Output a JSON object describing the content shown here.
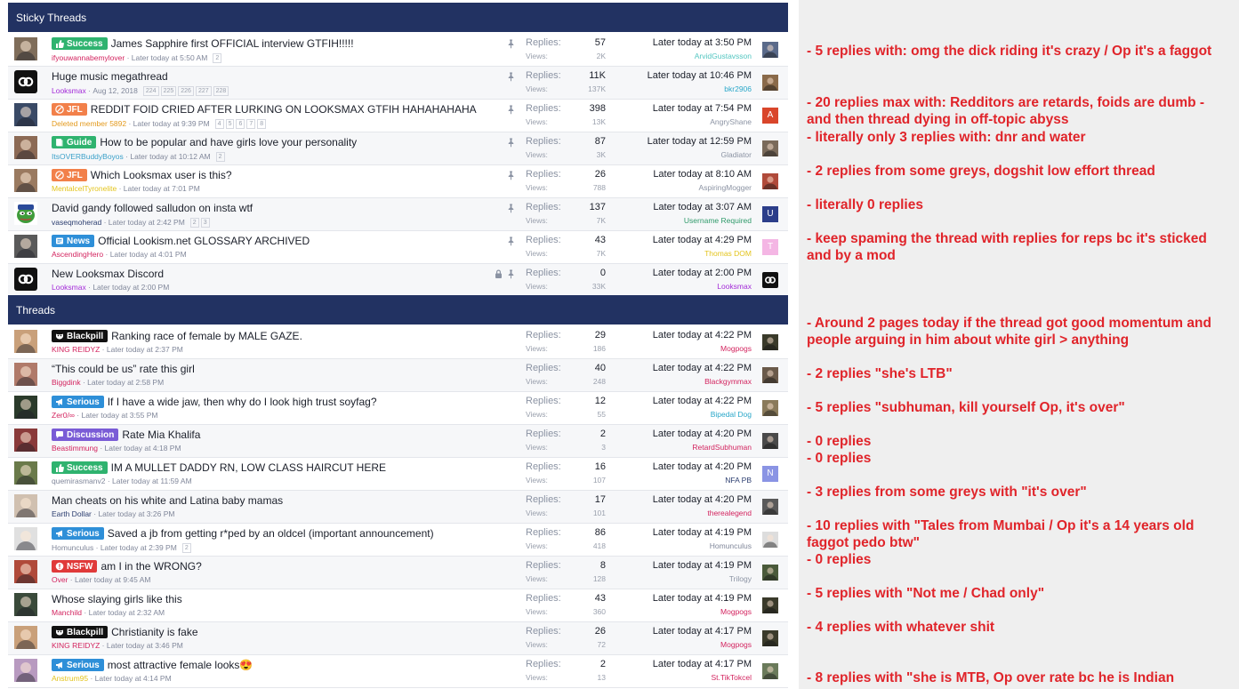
{
  "sticky_header": "Sticky Threads",
  "threads_header": "Threads",
  "labels": {
    "replies": "Replies:",
    "views": "Views:"
  },
  "sticky": [
    {
      "title": "James Sapphire first OFFICIAL interview GTFIH!!!!!",
      "prefix": "Success",
      "prefix_color": "#2fb36f",
      "prefix_icon": "thumbs-up-icon",
      "author": "ifyouwannabemylover",
      "author_color": "#d3245f",
      "date": "Later today at 5:50 AM",
      "pages": [
        "2"
      ],
      "replies": "57",
      "views": "2K",
      "last_time": "Later today at 3:50 PM",
      "last_user": "ArvidGustavsson",
      "last_user_color": "#53c6c1",
      "avatar_bg": "#7f6d5a",
      "mini_bg": "#5a6a8a",
      "locked": false
    },
    {
      "title": "Huge music megathread",
      "prefix": "",
      "author": "Looksmax",
      "author_color": "#a32bd8",
      "date": "Aug 12, 2018",
      "pages": [
        "224",
        "225",
        "226",
        "227",
        "228"
      ],
      "replies": "11K",
      "views": "137K",
      "last_time": "Later today at 10:46 PM",
      "last_user": "bkr2906",
      "last_user_color": "#2aa7c9",
      "avatar_bg": "#111111",
      "avatar_logo": true,
      "mini_bg": "#8a6a4a",
      "locked": false
    },
    {
      "title": "REDDIT FOID CRIED AFTER LURKING ON LOOKSMAX GTFIH HAHAHAHAHA",
      "prefix": "JFL",
      "prefix_color": "#f2804a",
      "prefix_icon": "no-entry-icon",
      "author": "Deleted member 5892",
      "author_color": "#e39a1d",
      "date": "Later today at 9:39 PM",
      "pages": [
        "4",
        "5",
        "6",
        "7",
        "8"
      ],
      "replies": "398",
      "views": "13K",
      "last_time": "Later today at 7:54 PM",
      "last_user": "AngryShane",
      "last_user_color": "#8b93a3",
      "avatar_bg": "#3a4a66",
      "mini_bg": "#d9462b",
      "mini_letter": "A",
      "locked": false
    },
    {
      "title": "How to be popular and have girls love your personality",
      "prefix": "Guide",
      "prefix_color": "#2fb36f",
      "prefix_icon": "book-icon",
      "author": "ItsOVERBuddyBoyos",
      "author_color": "#3aa0c9",
      "date": "Later today at 10:12 AM",
      "pages": [
        "2"
      ],
      "replies": "87",
      "views": "3K",
      "last_time": "Later today at 12:59 PM",
      "last_user": "Gladiator",
      "last_user_color": "#8b93a3",
      "avatar_bg": "#8c6a55",
      "mini_bg": "#7a6a5a",
      "locked": false
    },
    {
      "title": "Which Looksmax user is this?",
      "prefix": "JFL",
      "prefix_color": "#f2804a",
      "prefix_icon": "no-entry-icon",
      "author": "MentalcelTyronelite",
      "author_color": "#e3c41d",
      "date": "Later today at 7:01 PM",
      "pages": [],
      "replies": "26",
      "views": "788",
      "last_time": "Later today at 8:10 AM",
      "last_user": "AspiringMogger",
      "last_user_color": "#8b93a3",
      "avatar_bg": "#9a7a60",
      "mini_bg": "#b04a3a",
      "locked": false
    },
    {
      "title": "David gandy followed salludon on insta wtf",
      "prefix": "",
      "author": "vaseqmoherad",
      "author_color": "#2c3e70",
      "date": "Later today at 2:42 PM",
      "pages": [
        "2",
        "3"
      ],
      "replies": "137",
      "views": "7K",
      "last_time": "Later today at 3:07 AM",
      "last_user": "Username Required",
      "last_user_color": "#2f9a6a",
      "avatar_bg": "#ffffff",
      "avatar_pepe": true,
      "mini_bg": "#2c3e8a",
      "mini_letter": "U",
      "locked": false
    },
    {
      "title": "Official Lookism.net GLOSSARY ARCHIVED",
      "prefix": "News",
      "prefix_color": "#2e8fd8",
      "prefix_icon": "newspaper-icon",
      "author": "AscendingHero",
      "author_color": "#d3245f",
      "date": "Later today at 4:01 PM",
      "pages": [],
      "replies": "43",
      "views": "7K",
      "last_time": "Later today at 4:29 PM",
      "last_user": "Thomas DOM",
      "last_user_color": "#e3c41d",
      "avatar_bg": "#5a5a5a",
      "mini_bg": "#f4b6e4",
      "mini_letter": "T",
      "locked": false
    },
    {
      "title": "New Looksmax Discord",
      "prefix": "",
      "author": "Looksmax",
      "author_color": "#a32bd8",
      "date": "Later today at 2:00 PM",
      "pages": [],
      "replies": "0",
      "views": "33K",
      "last_time": "Later today at 2:00 PM",
      "last_user": "Looksmax",
      "last_user_color": "#a32bd8",
      "avatar_bg": "#111111",
      "avatar_logo": true,
      "mini_bg": "#111111",
      "mini_logo": true,
      "locked": true
    }
  ],
  "threads": [
    {
      "title": "Ranking race of female by MALE GAZE.",
      "prefix": "Blackpill",
      "prefix_color": "#111111",
      "prefix_icon": "mask-icon",
      "author": "KING REIDYZ",
      "author_color": "#d3245f",
      "date": "Later today at 2:37 PM",
      "pages": [],
      "replies": "29",
      "views": "186",
      "last_time": "Later today at 4:22 PM",
      "last_user": "Mogpogs",
      "last_user_color": "#d3245f",
      "avatar_bg": "#c9a07a",
      "mini_bg": "#3a3a2a"
    },
    {
      "title": "“This could be us” rate this girl",
      "prefix": "",
      "author": "Biggdink",
      "author_color": "#d3245f",
      "date": "Later today at 2:58 PM",
      "pages": [],
      "replies": "40",
      "views": "248",
      "last_time": "Later today at 4:22 PM",
      "last_user": "Blackgymmax",
      "last_user_color": "#d3245f",
      "avatar_bg": "#b07a6a",
      "mini_bg": "#6a5a4a"
    },
    {
      "title": "If I have a wide jaw, then why do I look high trust soyfag?",
      "prefix": "Serious",
      "prefix_color": "#2e8fd8",
      "prefix_icon": "megaphone-icon",
      "author": "Zer0/∞",
      "author_color": "#d3245f",
      "date": "Later today at 3:55 PM",
      "pages": [],
      "replies": "12",
      "views": "55",
      "last_time": "Later today at 4:22 PM",
      "last_user": "Bipedal Dog",
      "last_user_color": "#2aa7c9",
      "avatar_bg": "#2a3a2a",
      "mini_bg": "#8a7a5a"
    },
    {
      "title": "Rate Mia Khalifa",
      "prefix": "Discussion",
      "prefix_color": "#7a5cd6",
      "prefix_icon": "chat-icon",
      "author": "Beastimmung",
      "author_color": "#d3245f",
      "date": "Later today at 4:18 PM",
      "pages": [],
      "replies": "2",
      "views": "3",
      "last_time": "Later today at 4:20 PM",
      "last_user": "RetardSubhuman",
      "last_user_color": "#d3245f",
      "avatar_bg": "#8a3a3a",
      "mini_bg": "#4a4a4a"
    },
    {
      "title": "IM A MULLET DADDY RN, LOW CLASS HAIRCUT HERE",
      "prefix": "Success",
      "prefix_color": "#2fb36f",
      "prefix_icon": "thumbs-up-icon",
      "author": "quemirasmanv2",
      "author_color": "#80879a",
      "date": "Later today at 11:59 AM",
      "pages": [],
      "replies": "16",
      "views": "107",
      "last_time": "Later today at 4:20 PM",
      "last_user": "NFA PB",
      "last_user_color": "#2c3e70",
      "avatar_bg": "#6a7a4a",
      "mini_bg": "#8a94e4",
      "mini_letter": "N"
    },
    {
      "title": "Man cheats on his white and Latina baby mamas",
      "prefix": "",
      "author": "Earth Dollar",
      "author_color": "#2c3e70",
      "date": "Later today at 3:26 PM",
      "pages": [],
      "replies": "17",
      "views": "101",
      "last_time": "Later today at 4:20 PM",
      "last_user": "therealegend",
      "last_user_color": "#d3245f",
      "avatar_bg": "#d0c0b0",
      "mini_bg": "#5a5a5a"
    },
    {
      "title": "Saved a jb from getting r*ped by an oldcel (important announcement)",
      "prefix": "Serious",
      "prefix_color": "#2e8fd8",
      "prefix_icon": "megaphone-icon",
      "author": "Homunculus",
      "author_color": "#80879a",
      "date": "Later today at 2:39 PM",
      "pages": [
        "2"
      ],
      "replies": "86",
      "views": "418",
      "last_time": "Later today at 4:19 PM",
      "last_user": "Homunculus",
      "last_user_color": "#80879a",
      "avatar_bg": "#e0e0e0",
      "mini_bg": "#dddddd"
    },
    {
      "title": "am I in the WRONG?",
      "prefix": "NSFW",
      "prefix_color": "#e03a3a",
      "prefix_icon": "alert-icon",
      "author": "Over",
      "author_color": "#d3245f",
      "date": "Later today at 9:45 AM",
      "pages": [],
      "replies": "8",
      "views": "128",
      "last_time": "Later today at 4:19 PM",
      "last_user": "Trilogy",
      "last_user_color": "#8b93a3",
      "avatar_bg": "#b04a3a",
      "mini_bg": "#4a5a3a"
    },
    {
      "title": "Whose slaying girls like this",
      "prefix": "",
      "author": "Manchild",
      "author_color": "#d3245f",
      "date": "Later today at 2:32 AM",
      "pages": [],
      "replies": "43",
      "views": "360",
      "last_time": "Later today at 4:19 PM",
      "last_user": "Mogpogs",
      "last_user_color": "#d3245f",
      "avatar_bg": "#3a4a3a",
      "mini_bg": "#3a3a2a"
    },
    {
      "title": "Christianity is fake",
      "prefix": "Blackpill",
      "prefix_color": "#111111",
      "prefix_icon": "mask-icon",
      "author": "KING REIDYZ",
      "author_color": "#d3245f",
      "date": "Later today at 3:46 PM",
      "pages": [],
      "replies": "26",
      "views": "72",
      "last_time": "Later today at 4:17 PM",
      "last_user": "Mogpogs",
      "last_user_color": "#d3245f",
      "avatar_bg": "#c9a07a",
      "mini_bg": "#3a3a2a"
    },
    {
      "title": "most attractive female looks😍",
      "prefix": "Serious",
      "prefix_color": "#2e8fd8",
      "prefix_icon": "megaphone-icon",
      "author": "Anstrum95",
      "author_color": "#e3c41d",
      "date": "Later today at 4:14 PM",
      "pages": [],
      "replies": "2",
      "views": "13",
      "last_time": "Later today at 4:17 PM",
      "last_user": "St.TikTokcel",
      "last_user_color": "#d3245f",
      "avatar_bg": "#b89ac0",
      "mini_bg": "#6a7a5a"
    }
  ],
  "notes": [
    {
      "text": "- 5 replies with: omg the dick riding it's crazy / Op it's a faggot"
    },
    {
      "text": "- 20 replies max with: Redditors are retards, foids are dumb - and then thread dying in off-topic abyss"
    },
    {
      "text": "- literally only 3 replies with: dnr and water"
    },
    {
      "text": "- 2 replies from some greys, dogshit low effort thread"
    },
    {
      "text": "- literally 0 replies"
    },
    {
      "text": "- keep spaming the thread with replies for reps bc it's sticked and by a mod"
    },
    {
      "text": "- Around 2 pages today if the thread got good momentum and people arguing in him about white girl > anything"
    },
    {
      "text": "- 2 replies \"she's LTB\""
    },
    {
      "text": "- 5 replies \"subhuman, kill yourself Op, it's over\""
    },
    {
      "text": "- 0 replies"
    },
    {
      "text": "- 0 replies"
    },
    {
      "text": "- 3 replies from some greys with \"it's over\""
    },
    {
      "text": "- 10 replies with \"Tales from Mumbai / Op it's a 14 years old faggot pedo btw\""
    },
    {
      "text": "- 0 replies"
    },
    {
      "text": "- 5 replies with \"Not me / Chad only\""
    },
    {
      "text": "- 4 replies with whatever shit"
    },
    {
      "text": "- 8 replies with \"she is MTB, Op over rate bc he is Indian"
    }
  ]
}
